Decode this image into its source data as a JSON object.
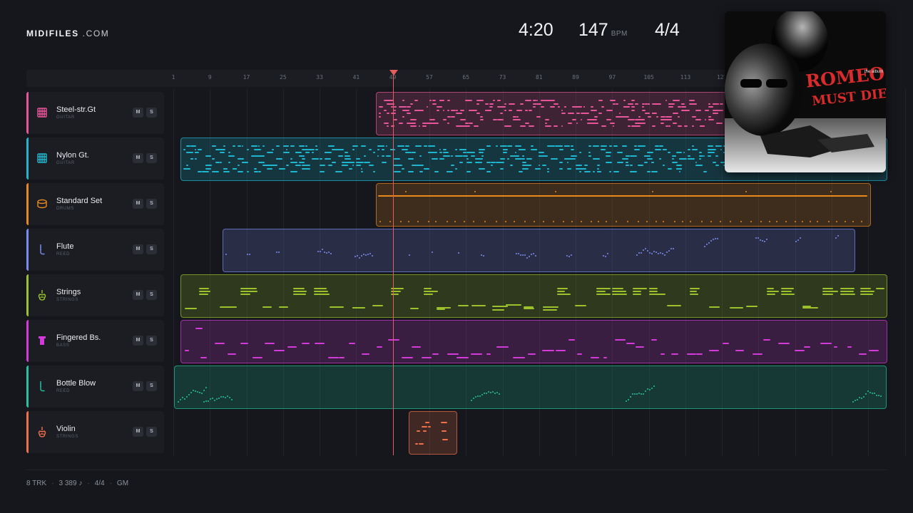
{
  "brand": {
    "name": "MIDIFILES",
    "suffix": ".COM"
  },
  "header": {
    "time": "4:20",
    "bpm": "147",
    "bpm_unit": "BPM",
    "time_signature": "4/4"
  },
  "ruler": {
    "bars": [
      "1",
      "9",
      "17",
      "25",
      "33",
      "41",
      "49",
      "57",
      "65",
      "73",
      "81",
      "89",
      "97",
      "105",
      "113",
      "121"
    ]
  },
  "playhead_bar": 49,
  "tracks": [
    {
      "name": "Steel-str.Gt",
      "category": "GUITAR",
      "color": "#e8559a",
      "icon": "guitar-icon",
      "mute": "M",
      "solo": "S"
    },
    {
      "name": "Nylon Gt.",
      "category": "GUITAR",
      "color": "#1fb6cf",
      "icon": "guitar-icon",
      "mute": "M",
      "solo": "S"
    },
    {
      "name": "Standard Set",
      "category": "DRUMS",
      "color": "#e8891e",
      "icon": "drum-icon",
      "mute": "M",
      "solo": "S"
    },
    {
      "name": "Flute",
      "category": "REED",
      "color": "#7b8cf0",
      "icon": "flute-icon",
      "mute": "M",
      "solo": "S"
    },
    {
      "name": "Strings",
      "category": "STRINGS",
      "color": "#9bc22a",
      "icon": "strings-icon",
      "mute": "M",
      "solo": "S"
    },
    {
      "name": "Fingered Bs.",
      "category": "BASS",
      "color": "#d23ad9",
      "icon": "bass-icon",
      "mute": "M",
      "solo": "S"
    },
    {
      "name": "Bottle Blow",
      "category": "REED",
      "color": "#23c2a0",
      "icon": "flute-icon",
      "mute": "M",
      "solo": "S"
    },
    {
      "name": "Violin",
      "category": "STRINGS",
      "color": "#f0704a",
      "icon": "violin-icon",
      "mute": "M",
      "solo": "S"
    }
  ],
  "album": {
    "title_line1": "ROMEO",
    "title_line2": "MUST DIE",
    "tag": "the album"
  },
  "footer": {
    "tracks": "8 TRK",
    "notes": "3 389 ♪",
    "signature": "4/4",
    "standard": "GM"
  }
}
